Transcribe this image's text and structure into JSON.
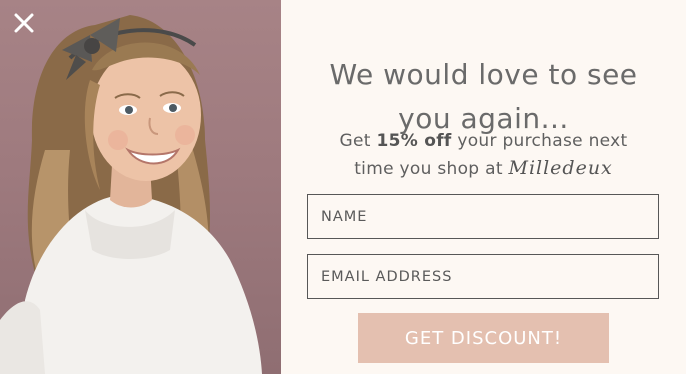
{
  "popup": {
    "close_icon": "close-icon",
    "headline": {
      "line1": "We would love to see",
      "line2": "you again..."
    },
    "offer": {
      "prefix": "Get ",
      "discount": "15% off",
      "middle": " your purchase next",
      "line2": "time you shop at ",
      "brand": "Milledeux"
    },
    "form": {
      "name_placeholder": "NAME",
      "email_placeholder": "EMAIL ADDRESS",
      "submit_label": "GET DISCOUNT!"
    }
  },
  "colors": {
    "panel_background": "#fdf8f3",
    "button_background": "#e4c0b0",
    "text": "#666666",
    "photo_background": "#a78386"
  }
}
